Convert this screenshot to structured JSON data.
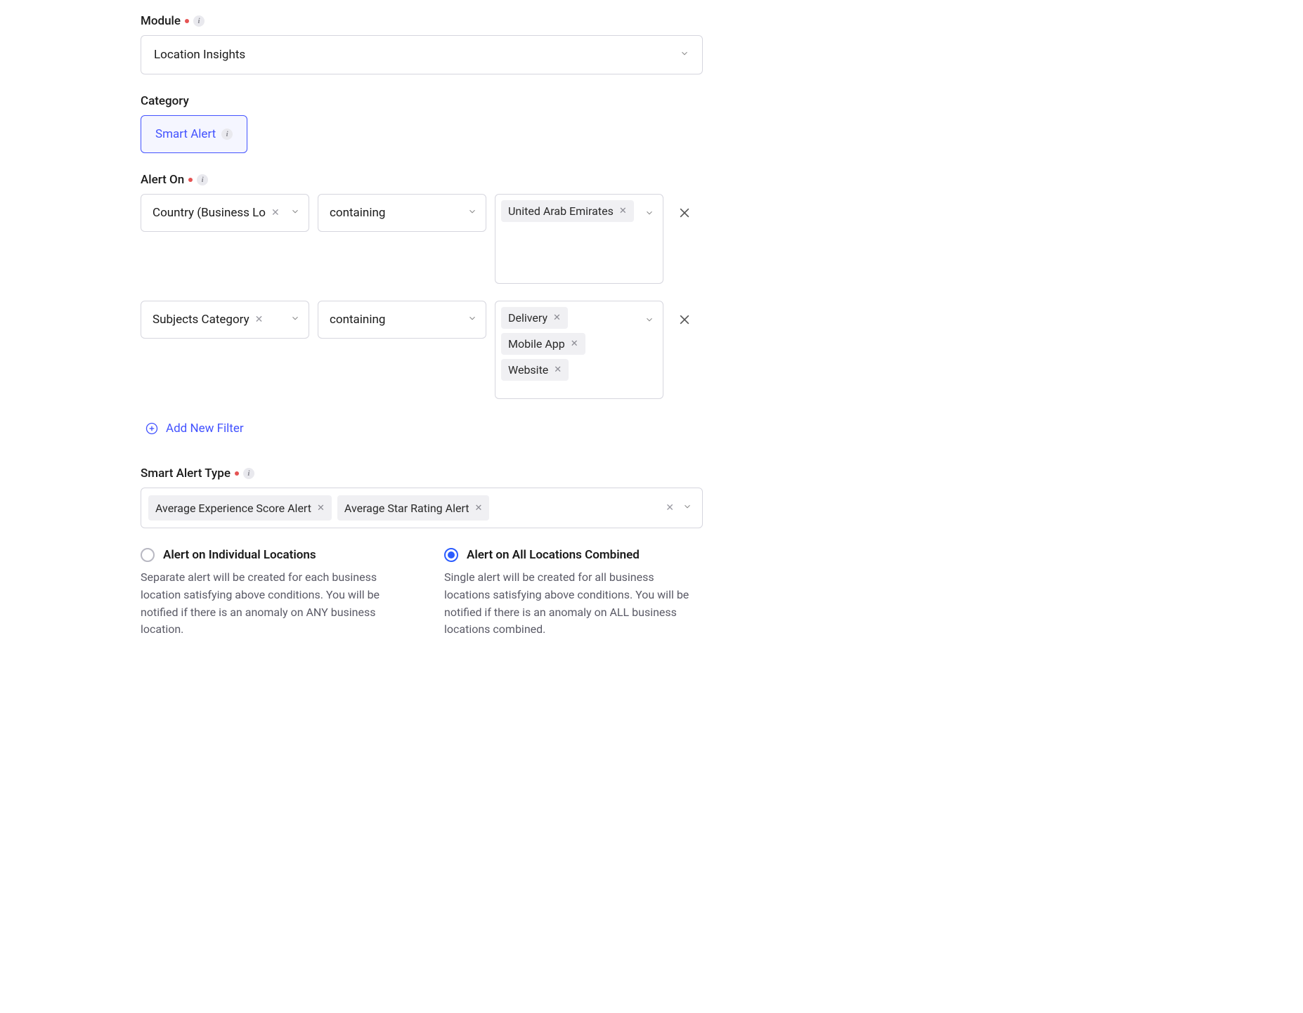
{
  "module": {
    "label": "Module",
    "value": "Location Insights"
  },
  "category": {
    "label": "Category",
    "chip": "Smart Alert"
  },
  "alert_on": {
    "label": "Alert On",
    "filters": [
      {
        "field": "Country (Business Lo",
        "operator": "containing",
        "values": [
          "United Arab Emirates"
        ]
      },
      {
        "field": "Subjects Category",
        "operator": "containing",
        "values": [
          "Delivery",
          "Mobile App",
          "Website"
        ]
      }
    ],
    "add_filter_label": "Add New Filter"
  },
  "smart_alert_type": {
    "label": "Smart Alert Type",
    "values": [
      "Average Experience Score Alert",
      "Average Star Rating Alert"
    ]
  },
  "scope_options": [
    {
      "title": "Alert on Individual Locations",
      "desc": "Separate alert will be created for each business location satisfying above conditions. You will be notified if there is an anomaly on ANY business location.",
      "selected": false
    },
    {
      "title": "Alert on All Locations Combined",
      "desc": "Single alert will be created for all business locations satisfying above conditions. You will be notified if there is an anomaly on ALL business locations combined.",
      "selected": true
    }
  ]
}
